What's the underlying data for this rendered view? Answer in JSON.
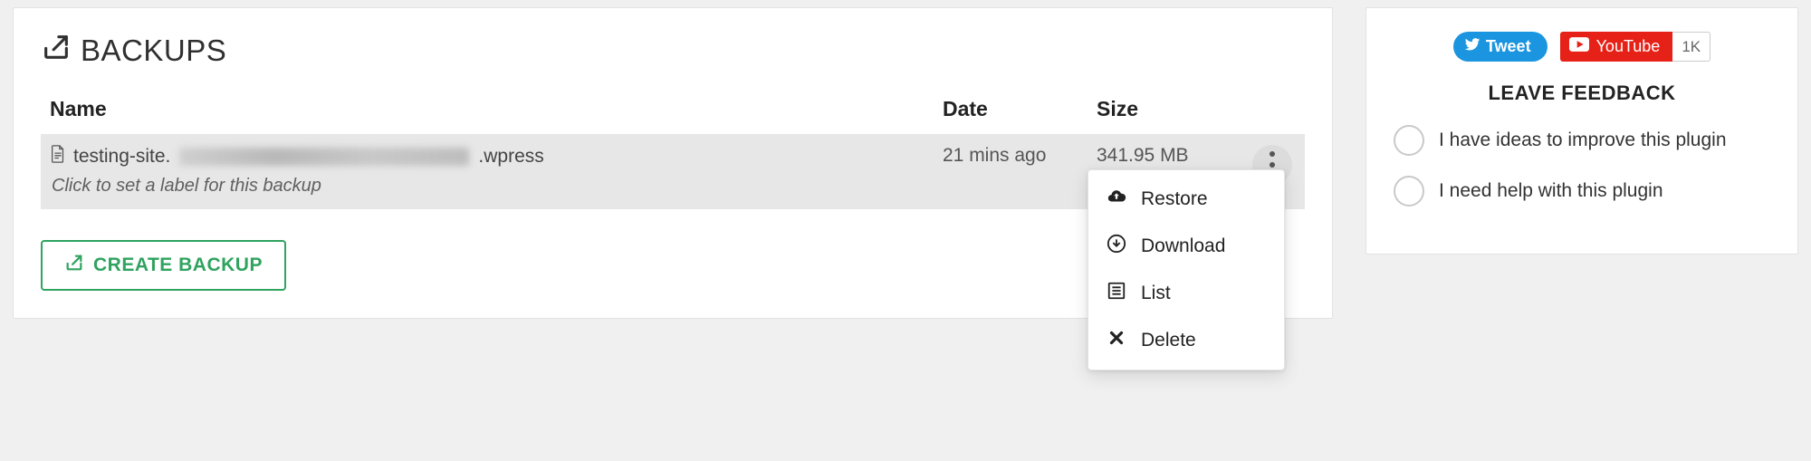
{
  "main": {
    "title": "BACKUPS",
    "columns": {
      "name": "Name",
      "date": "Date",
      "size": "Size"
    },
    "row": {
      "filename_prefix": "testing-site.",
      "filename_suffix": ".wpress",
      "label_hint": "Click to set a label for this backup",
      "date": "21 mins ago",
      "size": "341.95 MB"
    },
    "create_button": "CREATE BACKUP",
    "dropdown": {
      "restore": "Restore",
      "download": "Download",
      "list": "List",
      "delete": "Delete"
    }
  },
  "sidebar": {
    "tweet_label": "Tweet",
    "youtube_label": "YouTube",
    "youtube_count": "1K",
    "feedback_title": "LEAVE FEEDBACK",
    "options": {
      "improve": "I have ideas to improve this plugin",
      "help": "I need help with this plugin"
    }
  }
}
